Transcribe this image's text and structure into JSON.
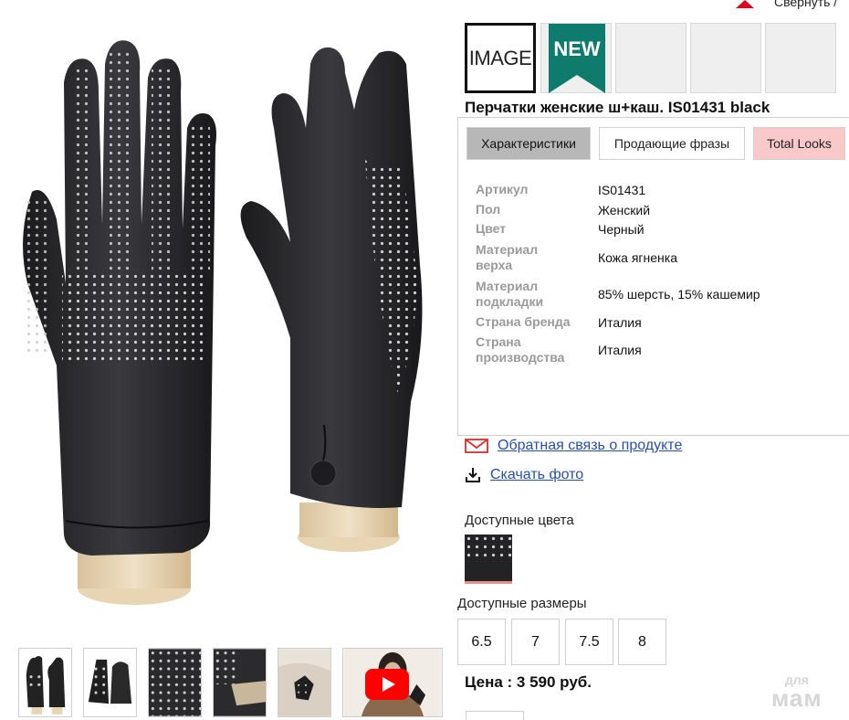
{
  "header": {
    "collapse_label": "Свернуть /"
  },
  "gallery": {
    "thumbnails": [
      {
        "name": "thumb-front-pair"
      },
      {
        "name": "thumb-folded-pair"
      },
      {
        "name": "thumb-studs-closeup"
      },
      {
        "name": "thumb-cuff-closeup"
      },
      {
        "name": "thumb-model-hands"
      },
      {
        "name": "thumb-video",
        "is_video": true
      }
    ]
  },
  "badges": {
    "image_label": "IMAGE",
    "new_label": "NEW",
    "new_color": "#0f7b6c"
  },
  "product": {
    "title": "Перчатки женские ш+каш. IS01431 black"
  },
  "tabs": [
    {
      "label": "Характеристики",
      "active": true
    },
    {
      "label": "Продающие фразы",
      "active": false
    },
    {
      "label": "Total Looks",
      "active": false
    }
  ],
  "specs": [
    {
      "label": "Артикул",
      "value": "IS01431"
    },
    {
      "label": "Пол",
      "value": "Женский"
    },
    {
      "label": "Цвет",
      "value": "Черный"
    },
    {
      "label": "Материал верха",
      "value": "Кожа ягненка"
    },
    {
      "label": "Материал подкладки",
      "value": "85% шерсть, 15% кашемир"
    },
    {
      "label": "Страна бренда",
      "value": "Италия"
    },
    {
      "label": "Страна производства",
      "value": "Италия"
    }
  ],
  "links": {
    "feedback": "Обратная связь о продукте",
    "download": "Скачать фото"
  },
  "colors": {
    "label": "Доступные цвета",
    "accent": "#e3001b"
  },
  "sizes": {
    "label": "Доступные размеры",
    "options": [
      "6.5",
      "7",
      "7.5",
      "8"
    ]
  },
  "price": {
    "text": "Цена : 3 590 руб."
  },
  "watermark": {
    "line1": "для",
    "line2": "мам"
  }
}
